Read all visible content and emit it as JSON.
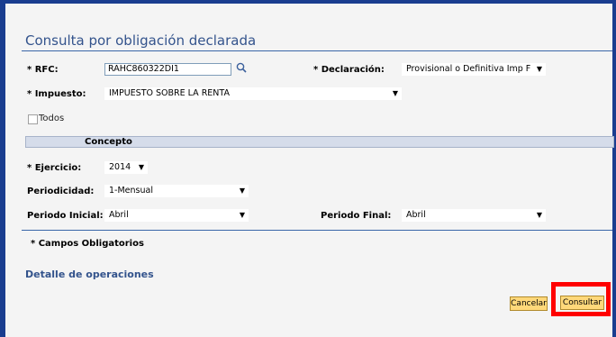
{
  "page": {
    "title": "Consulta por obligación declarada"
  },
  "rfc": {
    "label": "* RFC:",
    "value": "RAHC860322DI1"
  },
  "declaracion": {
    "label": "* Declaración:",
    "value": "Provisional o Definitiva Imp F"
  },
  "impuesto": {
    "label": "* Impuesto:",
    "value": "IMPUESTO SOBRE LA RENTA"
  },
  "todos": {
    "label": "Todos"
  },
  "concepto": {
    "header": "Concepto"
  },
  "ejercicio": {
    "label": "* Ejercicio:",
    "value": "2014"
  },
  "periodicidad": {
    "label": "Periodicidad:",
    "value": "1-Mensual"
  },
  "periodo_inicial": {
    "label": "Periodo Inicial:",
    "value": "Abril"
  },
  "periodo_final": {
    "label": "Periodo Final:",
    "value": "Abril"
  },
  "obligatorios": {
    "note": "* Campos Obligatorios"
  },
  "detalle": {
    "title": "Detalle de operaciones"
  },
  "buttons": {
    "cancelar": "Cancelar",
    "consultar": "Consultar"
  },
  "icons": {
    "dropdown_arrow": "▼",
    "search": "search-icon"
  },
  "colors": {
    "accent": "#33538c",
    "frame": "#1a3d8f",
    "button": "#ffd87a",
    "highlight": "#ff0000"
  }
}
